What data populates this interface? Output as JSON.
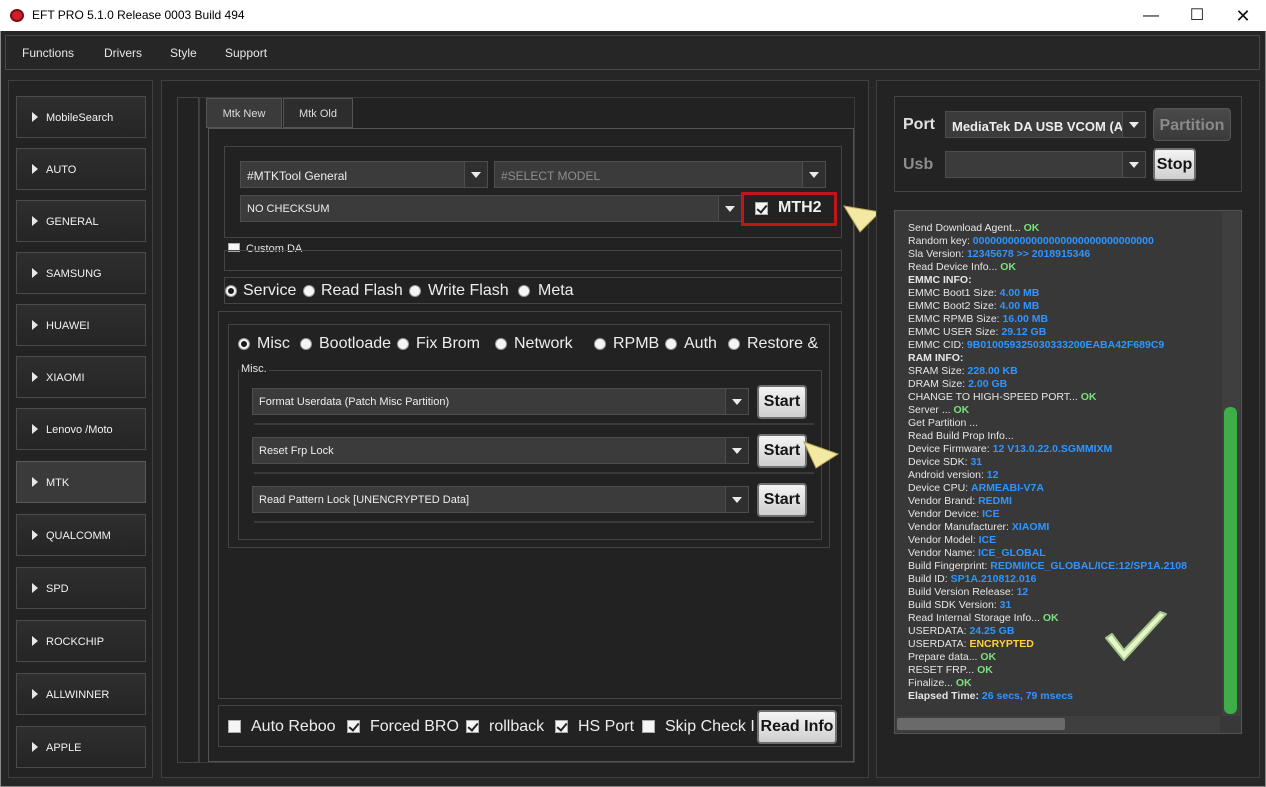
{
  "window": {
    "title": "EFT PRO 5.1.0 Release 0003 Build 494"
  },
  "menu": [
    "Functions",
    "Drivers",
    "Style",
    "Support"
  ],
  "sidebar": [
    "MobileSearch",
    "AUTO",
    "GENERAL",
    "SAMSUNG",
    "HUAWEI",
    "XIAOMI",
    "Lenovo /Moto",
    "MTK",
    "QUALCOMM",
    "SPD",
    "ROCKCHIP",
    "ALLWINNER",
    "APPLE"
  ],
  "tabs": [
    "Mtk New",
    "Mtk Old"
  ],
  "config": {
    "tool_value": "#MTKTool General",
    "model_placeholder": "#SELECT MODEL",
    "checksum_value": "NO CHECKSUM",
    "mth2_label": "MTH2",
    "custom_da_label": "Custom DA"
  },
  "modes": [
    "Service",
    "Read Flash",
    "Write Flash",
    "Meta"
  ],
  "subtabs": [
    "Misc",
    "Bootloade",
    "Fix Brom",
    "Network",
    "RPMB",
    "Auth",
    "Restore &"
  ],
  "misc": {
    "group_label": "Misc.",
    "ops": [
      "Format Userdata (Patch Misc Partition)",
      "Reset Frp Lock",
      "Read Pattern Lock [UNENCRYPTED Data]"
    ],
    "start_label": "Start"
  },
  "options": [
    "Auto Reboo",
    "Forced BRO",
    "rollback",
    "HS Port",
    "Skip Check I"
  ],
  "read_info_label": "Read Info",
  "port": {
    "port_label": "Port",
    "port_value": "MediaTek DA USB VCOM (Ar",
    "usb_label": "Usb",
    "partition_label": "Partition",
    "stop_label": "Stop"
  },
  "log": [
    {
      "t": "Send Download Agent... ",
      "v": "OK",
      "c": "ok"
    },
    {
      "t": "Random key:  ",
      "v": "0000000000000000000000000000000",
      "c": "blue"
    },
    {
      "t": "Sla Version:  ",
      "v": "12345678  >> 2018915346",
      "c": "blue"
    },
    {
      "t": "Read Device Info... ",
      "v": "OK",
      "c": "ok"
    },
    {
      "t": " EMMC INFO:",
      "v": "",
      "c": "",
      "bold": true
    },
    {
      "t": "EMMC Boot1 Size: ",
      "v": "4.00 MB",
      "c": "blue"
    },
    {
      "t": "EMMC Boot2 Size: ",
      "v": "4.00 MB",
      "c": "blue"
    },
    {
      "t": "EMMC RPMB Size: ",
      "v": "16.00 MB",
      "c": "blue"
    },
    {
      "t": "EMMC USER Size: ",
      "v": "29.12 GB",
      "c": "blue"
    },
    {
      "t": "EMMC CID: ",
      "v": "9B010059325030333200EABA42F689C9",
      "c": "blue"
    },
    {
      "t": " RAM INFO:",
      "v": "",
      "c": "",
      "bold": true
    },
    {
      "t": "SRAM Size: ",
      "v": "228.00 KB",
      "c": "blue"
    },
    {
      "t": "DRAM Size: ",
      "v": "2.00 GB",
      "c": "blue"
    },
    {
      "t": "CHANGE TO HIGH-SPEED PORT... ",
      "v": "OK",
      "c": "ok"
    },
    {
      "t": "Server ... ",
      "v": "OK",
      "c": "ok"
    },
    {
      "t": "Get Partition ...",
      "v": "",
      "c": ""
    },
    {
      "t": "Read Build Prop Info...",
      "v": "",
      "c": ""
    },
    {
      "t": " Device Firmware: ",
      "v": "12 V13.0.22.0.SGMMIXM",
      "c": "blue"
    },
    {
      "t": " Device SDK: ",
      "v": "31",
      "c": "blue"
    },
    {
      "t": " Android version: ",
      "v": "12",
      "c": "blue"
    },
    {
      "t": " Device CPU: ",
      "v": "ARMEABI-V7A",
      "c": "blue"
    },
    {
      "t": " Vendor Brand: ",
      "v": "REDMI",
      "c": "blue"
    },
    {
      "t": " Vendor Device: ",
      "v": "ICE",
      "c": "blue"
    },
    {
      "t": " Vendor Manufacturer: ",
      "v": "XIAOMI",
      "c": "blue"
    },
    {
      "t": " Vendor Model: ",
      "v": "ICE",
      "c": "blue"
    },
    {
      "t": " Vendor Name: ",
      "v": "ICE_GLOBAL",
      "c": "blue"
    },
    {
      "t": " Build Fingerprint: ",
      "v": "REDMI/ICE_GLOBAL/ICE:12/SP1A.2108",
      "c": "blue"
    },
    {
      "t": " Build ID: ",
      "v": "SP1A.210812.016",
      "c": "blue"
    },
    {
      "t": " Build Version Release: ",
      "v": "12",
      "c": "blue"
    },
    {
      "t": " Build SDK Version: ",
      "v": "31",
      "c": "blue"
    },
    {
      "t": "Read Internal Storage Info... ",
      "v": "OK",
      "c": "ok"
    },
    {
      "t": "USERDATA: ",
      "v": "24.25 GB",
      "c": "blue"
    },
    {
      "t": "USERDATA: ",
      "v": "ENCRYPTED",
      "c": "yel"
    },
    {
      "t": "Prepare data... ",
      "v": "OK",
      "c": "ok"
    },
    {
      "t": "RESET FRP... ",
      "v": "OK",
      "c": "ok"
    },
    {
      "t": "Finalize... ",
      "v": "OK",
      "c": "ok"
    },
    {
      "t": " Elapsed Time: ",
      "v": "26 secs, 79 msecs",
      "c": "blue",
      "bold": true
    }
  ]
}
